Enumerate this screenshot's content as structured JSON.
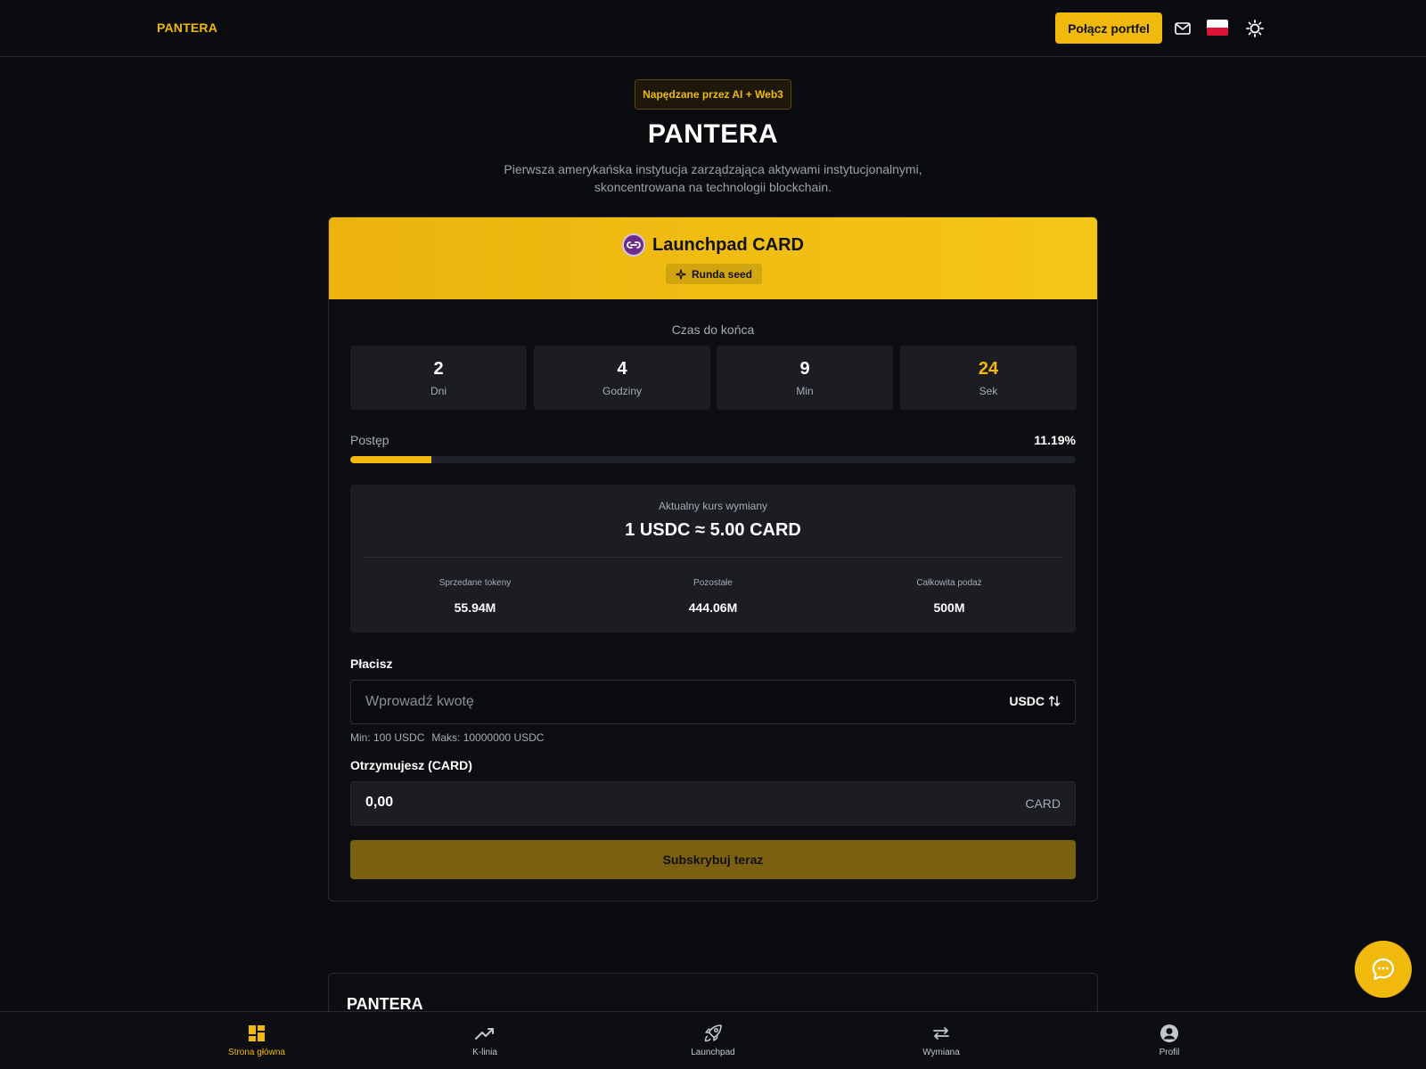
{
  "header": {
    "brand": "PANTERA",
    "connect_label": "Połącz portfel"
  },
  "hero": {
    "badge": "Napędzane przez AI + Web3",
    "title": "PANTERA",
    "subtitle_line1": "Pierwsza amerykańska instytucja zarządzająca aktywami instytucjonalnymi,",
    "subtitle_line2": "skoncentrowana na technologii blockchain."
  },
  "launchpad": {
    "title": "Launchpad CARD",
    "round": "Runda seed",
    "countdown_label": "Czas do końca",
    "countdown": [
      {
        "value": "2",
        "unit": "Dni"
      },
      {
        "value": "4",
        "unit": "Godziny"
      },
      {
        "value": "9",
        "unit": "Min"
      },
      {
        "value": "24",
        "unit": "Sek"
      }
    ],
    "progress_label": "Postęp",
    "progress_text": "11.19%",
    "progress_fraction": 0.1119,
    "rate_label": "Aktualny kurs wymiany",
    "rate_value": "1 USDC ≈ 5.00 CARD",
    "stats": [
      {
        "label": "Sprzedane tokeny",
        "value": "55.94M"
      },
      {
        "label": "Pozostałe",
        "value": "444.06M"
      },
      {
        "label": "Całkowita podaż",
        "value": "500M"
      }
    ],
    "pay_label": "Płacisz",
    "pay_placeholder": "Wprowadź kwotę",
    "pay_currency": "USDC",
    "min_text": "Min: 100 USDC",
    "max_text": "Maks: 10000000 USDC",
    "receive_label": "Otrzymujesz (CARD)",
    "receive_value": "0,00",
    "receive_unit": "CARD",
    "subscribe_label": "Subskrybuj teraz"
  },
  "section2": {
    "title": "PANTERA"
  },
  "bottom_nav": [
    {
      "label": "Strona główna",
      "icon": "dashboard-icon",
      "active": true
    },
    {
      "label": "K-linia",
      "icon": "trending-up-icon",
      "active": false
    },
    {
      "label": "Launchpad",
      "icon": "rocket-icon",
      "active": false
    },
    {
      "label": "Wymiana",
      "icon": "swap-icon",
      "active": false
    },
    {
      "label": "Profil",
      "icon": "user-circle-icon",
      "active": false
    }
  ],
  "colors": {
    "accent": "#f0b90b",
    "background": "#0b0c0f",
    "panel": "#1b1d23"
  }
}
